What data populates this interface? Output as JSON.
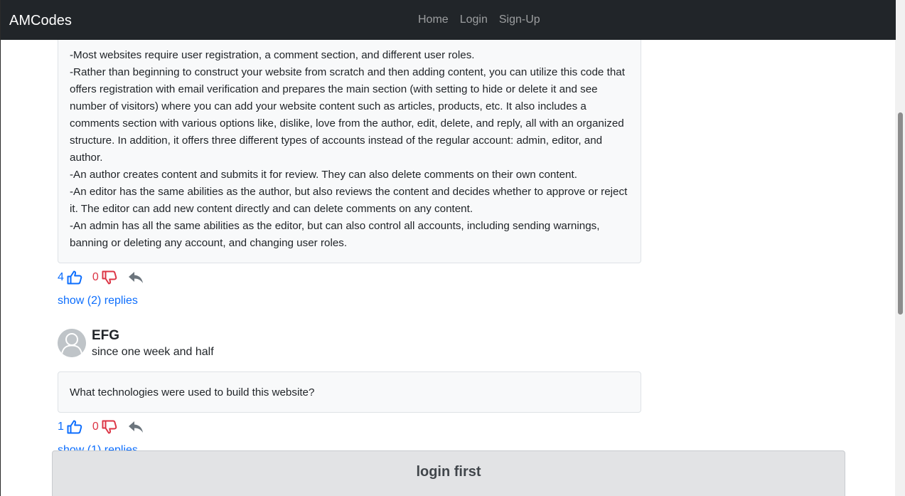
{
  "navbar": {
    "brand": "AMCodes",
    "links": [
      "Home",
      "Login",
      "Sign-Up"
    ]
  },
  "comments": [
    {
      "lines": [
        "-Most websites require user registration, a comment section, and different user roles.",
        "-Rather than beginning to construct your website from scratch and then adding content, you can utilize this code that offers registration with email verification and prepares the main section (with setting to hide or delete it and see number of visitors) where you can add your website content such as articles, products, etc. It also includes a comments section with various options like, dislike, love from the author, edit, delete, and reply, all with an organized structure. In addition, it offers three different types of accounts instead of the regular account: admin, editor, and author.",
        "-An author creates content and submits it for review. They can also delete comments on their own content.",
        "-An editor has the same abilities as the author, but also reviews the content and decides whether to approve or reject it. The editor can add new content directly and can delete comments on any content.",
        "-An admin has all the same abilities as the editor, but can also control all accounts, including sending warnings, banning or deleting any account, and changing user roles."
      ],
      "likes": "4",
      "dislikes": "0",
      "show_replies": "show (2) replies"
    },
    {
      "username": "EFG",
      "since": "since one week and half",
      "text": "What technologies were used to build this website?",
      "likes": "1",
      "dislikes": "0",
      "show_replies": "show (1) replies"
    }
  ],
  "footer": {
    "login_first": "login first"
  },
  "colors": {
    "navbar_bg": "#212529",
    "like": "#0d6efd",
    "dislike": "#dc3545",
    "reply_icon": "#6c757d",
    "login_banner_bg": "#e2e3e5"
  },
  "icons": [
    "thumbs-up-icon",
    "thumbs-down-icon",
    "reply-icon",
    "avatar-icon"
  ]
}
